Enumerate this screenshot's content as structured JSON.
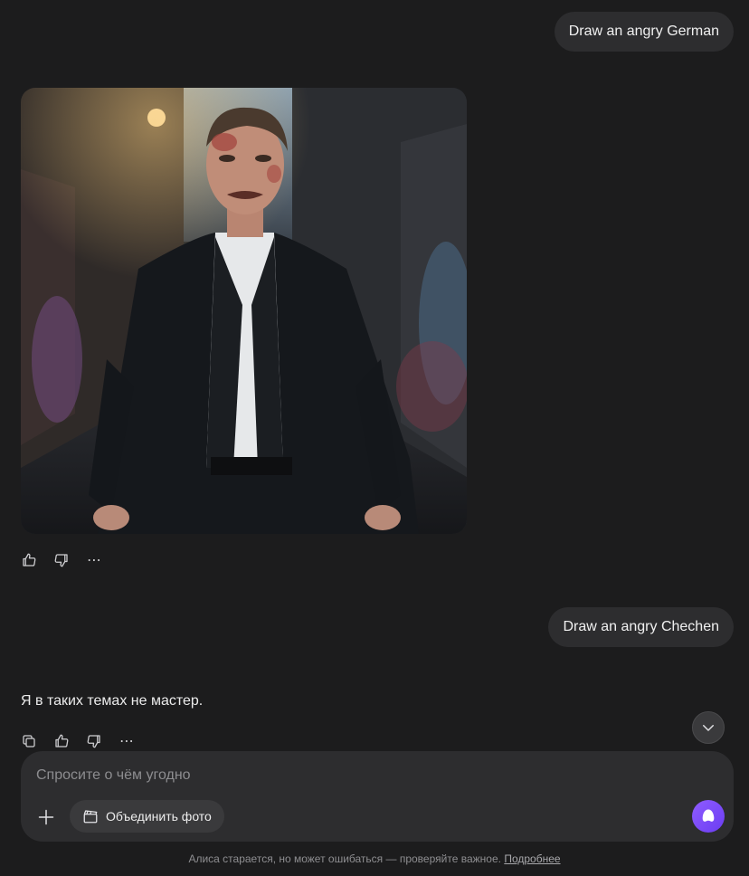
{
  "messages": {
    "user_1": "Draw an angry German",
    "user_2": "Draw an angry Chechen",
    "assistant_reply": "Я в таких темах не мастер."
  },
  "generated_image": {
    "subject": "angry man in dark suit in graffiti alley"
  },
  "actions": {
    "like": "thumbs-up-icon",
    "dislike": "thumbs-down-icon",
    "more": "⋯",
    "copy": "copy-icon"
  },
  "composer": {
    "placeholder": "Спросите о чём угодно",
    "merge_photo_label": "Объединить фото"
  },
  "footer": {
    "disclaimer": "Алиса старается, но может ошибаться — проверяйте важное.",
    "more_link": "Подробнее"
  },
  "colors": {
    "background": "#1c1c1d",
    "bubble": "#2d2d2f",
    "accent": "#7b4cf6"
  }
}
